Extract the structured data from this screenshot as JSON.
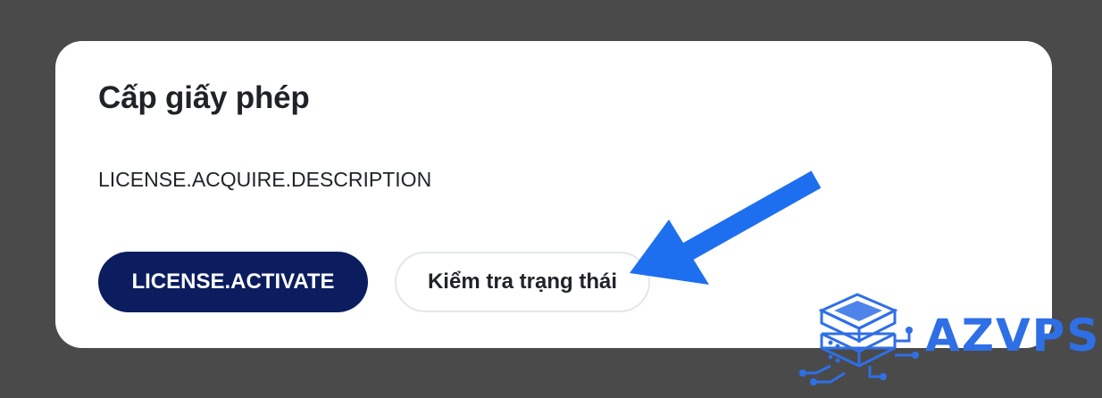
{
  "dialog": {
    "title": "Cấp giấy phép",
    "description": "LICENSE.ACQUIRE.DESCRIPTION",
    "activate_label": "LICENSE.ACTIVATE",
    "check_status_label": "Kiểm tra trạng thái"
  },
  "annotation": {
    "arrow_color": "#1e6ff0",
    "arrow_target": "check-status-button"
  },
  "watermark": {
    "text": "AZVPS",
    "color": "#2f6fe6",
    "icon": "server-stack-icon"
  },
  "colors": {
    "backdrop": "#4a4a4a",
    "card": "#ffffff",
    "primary": "#0b1d5f",
    "text": "#1f2328"
  }
}
